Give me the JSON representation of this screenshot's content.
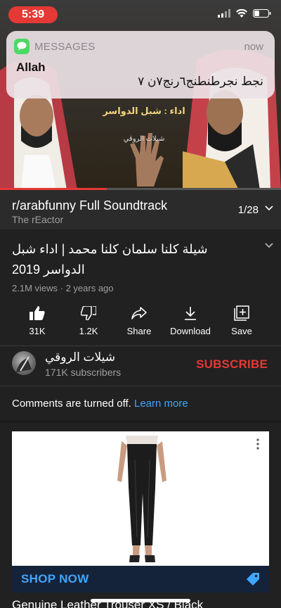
{
  "status_bar": {
    "time": "5:39"
  },
  "video": {
    "overlay_line1": "اداء : شبل الدواسر",
    "overlay_line2": "شيلات الروقي",
    "progress_fraction": 0.38
  },
  "notification": {
    "app": "MESSAGES",
    "time": "now",
    "sender": "Allah",
    "body": "نجط نجرطنطنج٦رنج٧ن ٧"
  },
  "playlist": {
    "title": "r/arabfunny Full Soundtrack",
    "channel": "The rEactor",
    "position": "1/28"
  },
  "video_info": {
    "title": "شيلة كلنا سلمان كلنا محمد | اداء شبل الدواسر 2019",
    "meta": "2.1M views · 2 years ago"
  },
  "actions": {
    "like_count": "31K",
    "dislike_count": "1.2K",
    "share_label": "Share",
    "download_label": "Download",
    "save_label": "Save"
  },
  "channel": {
    "name": "شيلات الروقي",
    "subscribers": "171K subscribers",
    "subscribe_label": "SUBSCRIBE"
  },
  "comments": {
    "text": "Comments are turned off.",
    "link": "Learn more"
  },
  "ad": {
    "cta": "SHOP NOW",
    "title": "Genuine Leather Trouser XS / Black"
  },
  "colors": {
    "accent_red": "#e53935",
    "link_blue": "#3ea6ff",
    "background": "#212121"
  }
}
